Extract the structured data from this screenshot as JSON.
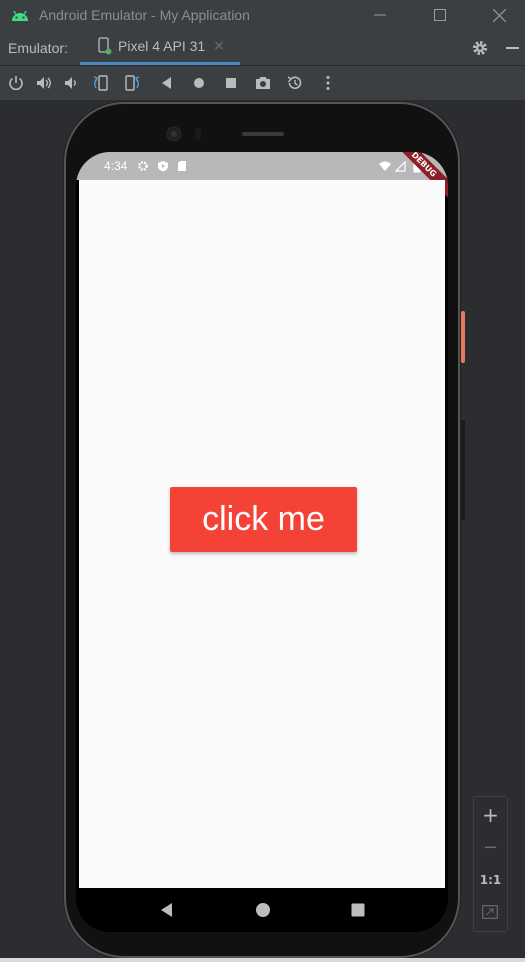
{
  "window": {
    "title": "Android Emulator - My Application"
  },
  "tabs": {
    "emulator_label": "Emulator:",
    "device_tab": "Pixel 4 API 31",
    "close_glyph": "×"
  },
  "toolbar": {
    "icons": [
      "power-icon",
      "volume-up-icon",
      "volume-down-icon",
      "rotate-left-icon",
      "rotate-right-icon",
      "back-icon",
      "home-icon",
      "overview-icon",
      "screenshot-icon",
      "snapshot-icon",
      "more-icon"
    ]
  },
  "device": {
    "status_time": "4:34",
    "debug_label": "DEBUG",
    "button_label": "click me"
  },
  "zoom": {
    "plus": "+",
    "minus": "−",
    "one_to_one": "1:1"
  },
  "colors": {
    "accent_tab": "#4a88c7",
    "button": "#f44336",
    "side_button": "#e8795e",
    "debug_banner": "#8e1f28"
  }
}
